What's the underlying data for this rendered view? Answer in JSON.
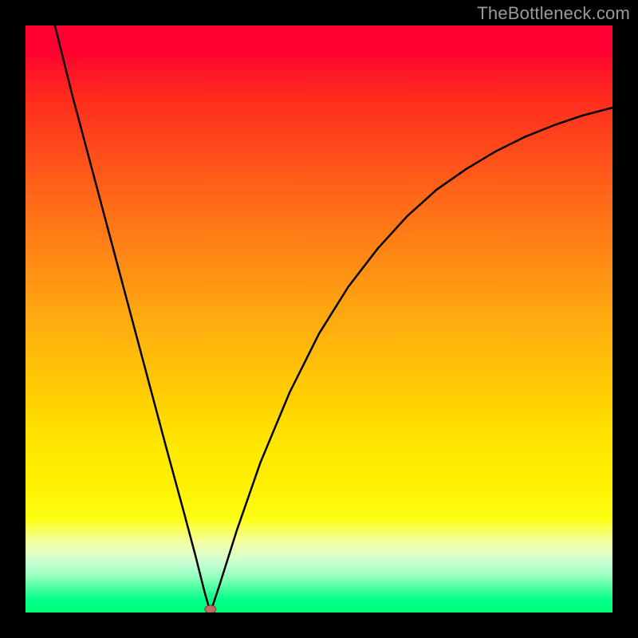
{
  "watermark": "TheBottleneck.com",
  "chart_data": {
    "type": "line",
    "title": "",
    "xlabel": "",
    "ylabel": "",
    "xlim": [
      0,
      100
    ],
    "ylim": [
      0,
      100
    ],
    "grid": false,
    "series": [
      {
        "name": "bottleneck-curve",
        "x": [
          5.0,
          8.0,
          12.0,
          16.0,
          20.0,
          24.0,
          27.0,
          29.0,
          30.5,
          31.5,
          33.0,
          36.0,
          40.0,
          45.0,
          50.0,
          55.0,
          60.0,
          65.0,
          70.0,
          75.0,
          80.0,
          85.0,
          90.0,
          95.0,
          100.0
        ],
        "y": [
          100.0,
          88.0,
          73.0,
          58.0,
          43.0,
          28.0,
          17.0,
          9.5,
          3.5,
          0.0,
          4.5,
          14.0,
          25.5,
          37.5,
          47.5,
          55.5,
          62.0,
          67.5,
          72.0,
          75.5,
          78.5,
          81.0,
          83.0,
          84.7,
          86.0
        ]
      }
    ],
    "annotations": [
      {
        "name": "optimal-point",
        "x": 31.5,
        "y": 0.0
      }
    ],
    "colors": {
      "curve": "#000000",
      "marker": "#c36a6a",
      "gradient_top": "#ff0030",
      "gradient_bottom": "#00ff78"
    }
  }
}
